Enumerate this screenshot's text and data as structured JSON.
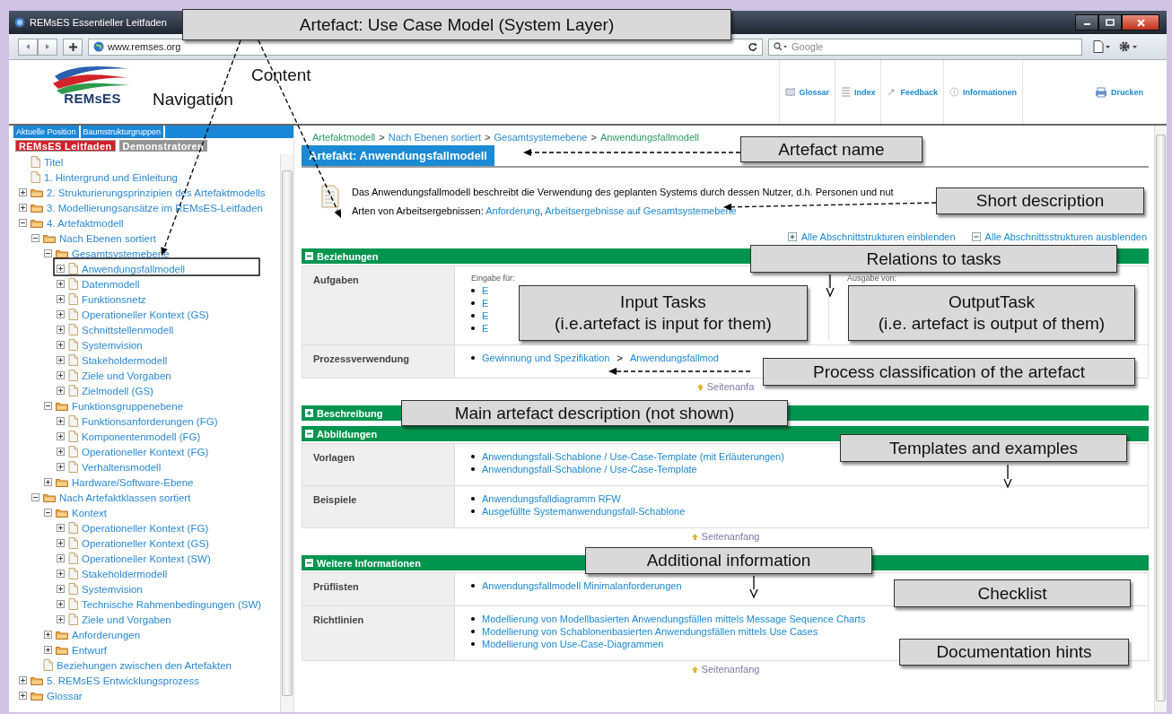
{
  "window": {
    "title": "REMsES Essentieller Leitfaden"
  },
  "navbar": {
    "url": "www.remses.org",
    "search_placeholder": "Google"
  },
  "header": {
    "logo_text": "REMsES",
    "links": [
      {
        "label": "Glossar"
      },
      {
        "label": "Index"
      },
      {
        "label": "Feedback"
      },
      {
        "label": "Informationen"
      }
    ],
    "print": "Drucken"
  },
  "sidebar": {
    "tabs": [
      {
        "label": "Aktuelle Position"
      },
      {
        "label": "Baumstrukturgruppen"
      }
    ],
    "guides": [
      {
        "label": "REMsES Leitfaden",
        "selected": true
      },
      {
        "label": "Demonstratoren",
        "selected": false
      }
    ],
    "tree": [
      {
        "label": "Titel",
        "kind": "document"
      },
      {
        "label": "1. Hintergrund und Einleitung",
        "kind": "document"
      },
      {
        "label": "2. Strukturierungsprinzipien des Artefaktmodells",
        "kind": "folder",
        "expanded": false
      },
      {
        "label": "3. Modellierungsansätze im REMsES-Leitfaden",
        "kind": "folder",
        "expanded": false
      },
      {
        "label": "4. Artefaktmodell",
        "kind": "folder",
        "expanded": true,
        "children": [
          {
            "label": "Nach Ebenen sortiert",
            "kind": "folder",
            "expanded": true,
            "children": [
              {
                "label": "Gesamtsystemebene",
                "kind": "folder",
                "expanded": true,
                "children": [
                  {
                    "label": "Anwendungsfallmodell",
                    "kind": "page",
                    "expanded": false
                  },
                  {
                    "label": "Datenmodell",
                    "kind": "page",
                    "expanded": false
                  },
                  {
                    "label": "Funktionsnetz",
                    "kind": "page",
                    "expanded": false
                  },
                  {
                    "label": "Operationeller Kontext (GS)",
                    "kind": "page",
                    "expanded": false
                  },
                  {
                    "label": "Schnittstellenmodell",
                    "kind": "page",
                    "expanded": false
                  },
                  {
                    "label": "Systemvision",
                    "kind": "page",
                    "expanded": false
                  },
                  {
                    "label": "Stakeholdermodell",
                    "kind": "page",
                    "expanded": false
                  },
                  {
                    "label": "Ziele und Vorgaben",
                    "kind": "page",
                    "expanded": false
                  },
                  {
                    "label": "Zielmodell (GS)",
                    "kind": "page",
                    "expanded": false
                  }
                ]
              },
              {
                "label": "Funktionsgruppenebene",
                "kind": "folder",
                "expanded": true,
                "children": [
                  {
                    "label": "Funktionsanforderungen (FG)",
                    "kind": "page",
                    "expanded": false
                  },
                  {
                    "label": "Komponentenmodell (FG)",
                    "kind": "page",
                    "expanded": false
                  },
                  {
                    "label": "Operationeller Kontext (FG)",
                    "kind": "page",
                    "expanded": false
                  },
                  {
                    "label": "Verhaltensmodell",
                    "kind": "page",
                    "expanded": false
                  }
                ]
              },
              {
                "label": "Hardware/Software-Ebene",
                "kind": "folder",
                "expanded": false
              }
            ]
          },
          {
            "label": "Nach Artefaktklassen sortiert",
            "kind": "folder",
            "expanded": true,
            "children": [
              {
                "label": "Kontext",
                "kind": "folder",
                "expanded": true,
                "children": [
                  {
                    "label": "Operationeller Kontext (FG)",
                    "kind": "page",
                    "expanded": false
                  },
                  {
                    "label": "Operationeller Kontext (GS)",
                    "kind": "page",
                    "expanded": false
                  },
                  {
                    "label": "Operationeller Kontext (SW)",
                    "kind": "page",
                    "expanded": false
                  },
                  {
                    "label": "Stakeholdermodell",
                    "kind": "page",
                    "expanded": false
                  },
                  {
                    "label": "Systemvision",
                    "kind": "page",
                    "expanded": false
                  },
                  {
                    "label": "Technische Rahmenbedingungen (SW)",
                    "kind": "page",
                    "expanded": false
                  },
                  {
                    "label": "Ziele und Vorgaben",
                    "kind": "page",
                    "expanded": false
                  }
                ]
              },
              {
                "label": "Anforderungen",
                "kind": "folder",
                "expanded": false
              },
              {
                "label": "Entwurf",
                "kind": "folder",
                "expanded": false
              }
            ]
          },
          {
            "label": "Beziehungen zwischen den Artefakten",
            "kind": "document"
          }
        ]
      },
      {
        "label": "5. REMsES Entwicklungsprozess",
        "kind": "folder",
        "expanded": false
      },
      {
        "label": "Glossar",
        "kind": "folder",
        "expanded": false
      }
    ]
  },
  "breadcrumb": {
    "separator": ">",
    "items": [
      {
        "label": "Artefaktmodell",
        "color": "#2a9d5c"
      },
      {
        "label": "Nach Ebenen sortiert",
        "color": "#2a8ad6"
      },
      {
        "label": "Gesamtsystemebene",
        "color": "#2a8ad6"
      },
      {
        "label": "Anwendungsfallmodell",
        "color": "#2a9d5c"
      }
    ]
  },
  "artefact": {
    "title": "Artefakt: Anwendungsfallmodell",
    "description": "Das Anwendungsfallmodell beschreibt die Verwendung des geplanten Systems durch dessen Nutzer, d.h. Personen und nut",
    "types_label": "Arten von Arbeitsergebnissen:",
    "types": [
      "Anforderung",
      "Arbeitsergebnisse auf Gesamtsystemebene"
    ],
    "types_separator": ", "
  },
  "section_controls": [
    {
      "label": "Alle Abschnittstrukturen einblenden",
      "kind": "expand"
    },
    {
      "label": "Alle Abschnittsstrukturen ausblenden",
      "kind": "collapse"
    }
  ],
  "sections": [
    {
      "title": "Beziehungen",
      "expanded": true,
      "top_link": "Seitenanfa",
      "rows": [
        {
          "kind": "io",
          "label": "Aufgaben",
          "columns": [
            {
              "heading": "Eingabe für:",
              "items": [
                "E",
                "E",
                "E",
                "E"
              ]
            },
            {
              "heading": "Ausgabe von:"
            }
          ]
        },
        {
          "kind": "path",
          "label": "Prozessverwendung",
          "path": [
            "Gewinnung und Spezifikation",
            "Anwendungsfallmod"
          ],
          "separator": ">"
        }
      ]
    },
    {
      "title": "Beschreibung",
      "expanded": false
    },
    {
      "title": "Abbildungen",
      "expanded": true,
      "top_link": "Seitenanfang",
      "rows": [
        {
          "kind": "links",
          "label": "Vorlagen",
          "items": [
            "Anwendungsfall-Schablone / Use-Case-Template (mit Erläuterungen)",
            "Anwendungsfall-Schablone / Use-Case-Template"
          ]
        },
        {
          "kind": "links",
          "label": "Beispiele",
          "items": [
            "Anwendungsfalldiagramm RFW",
            "Ausgefüllte Systemanwendungsfall-Schablone"
          ]
        }
      ]
    },
    {
      "title": "Weitere Informationen",
      "expanded": true,
      "top_link": "Seitenanfang",
      "rows": [
        {
          "kind": "links",
          "label": "Prüflisten",
          "items": [
            "Anwendungsfallmodell Minimalanforderungen"
          ]
        },
        {
          "kind": "links",
          "label": "Richtlinien",
          "items": [
            "Modellierung von Modellbasierten Anwendungsfällen mittels Message Sequence Charts",
            "Modellierung von Schablonenbasierten Anwendungsfällen mittels Use Cases",
            "Modellierung von Use-Case-Diagrammen"
          ]
        }
      ]
    }
  ],
  "annotations": [
    {
      "kind": "callout",
      "text": "Artefact: Use Case Model (System Layer)"
    },
    {
      "kind": "label",
      "text": "Content"
    },
    {
      "kind": "label",
      "text": "Navigation"
    },
    {
      "kind": "callout",
      "text": "Artefact name"
    },
    {
      "kind": "callout",
      "text": "Short description"
    },
    {
      "kind": "callout",
      "text": "Relations to tasks"
    },
    {
      "kind": "callout",
      "text": "Input Tasks\n(i.e.artefact is input for them)"
    },
    {
      "kind": "callout",
      "text": "OutputTask\n(i.e. artefact is output of them)"
    },
    {
      "kind": "callout",
      "text": "Process classification of the artefact"
    },
    {
      "kind": "callout",
      "text": "Main artefact description (not shown)"
    },
    {
      "kind": "callout",
      "text": "Templates and examples"
    },
    {
      "kind": "callout",
      "text": "Additional information"
    },
    {
      "kind": "callout",
      "text": "Checklist"
    },
    {
      "kind": "callout",
      "text": "Documentation hints"
    }
  ]
}
